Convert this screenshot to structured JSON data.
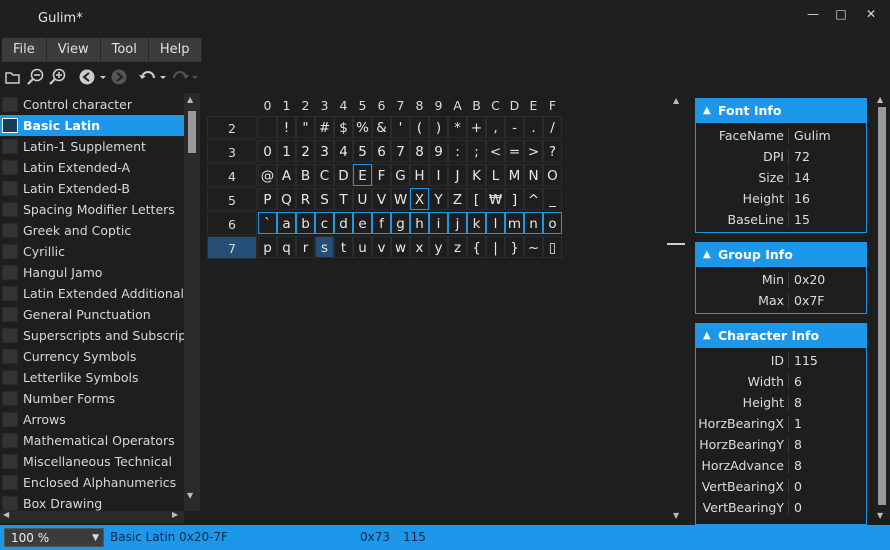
{
  "window": {
    "title": "Gulim*",
    "min_icon": "minimize-icon",
    "max_icon": "maximize-icon",
    "close_icon": "close-icon"
  },
  "menu": [
    {
      "label": "File"
    },
    {
      "label": "View"
    },
    {
      "label": "Tool"
    },
    {
      "label": "Help"
    }
  ],
  "toolbar": {
    "icons": [
      "open-folder-icon",
      "zoom-out-icon",
      "zoom-in-icon",
      "back-icon",
      "forward-icon",
      "undo-icon",
      "redo-icon"
    ]
  },
  "sidebar": {
    "items": [
      {
        "label": "Control character"
      },
      {
        "label": "Basic Latin"
      },
      {
        "label": "Latin-1 Supplement"
      },
      {
        "label": "Latin Extended-A"
      },
      {
        "label": "Latin Extended-B"
      },
      {
        "label": "Spacing Modifier Letters"
      },
      {
        "label": "Greek and Coptic"
      },
      {
        "label": "Cyrillic"
      },
      {
        "label": "Hangul Jamo"
      },
      {
        "label": "Latin Extended Additional"
      },
      {
        "label": "General Punctuation"
      },
      {
        "label": "Superscripts and Subscripts"
      },
      {
        "label": "Currency Symbols"
      },
      {
        "label": "Letterlike Symbols"
      },
      {
        "label": "Number Forms"
      },
      {
        "label": "Arrows"
      },
      {
        "label": "Mathematical Operators"
      },
      {
        "label": "Miscellaneous Technical"
      },
      {
        "label": "Enclosed Alphanumerics"
      },
      {
        "label": "Box Drawing"
      }
    ],
    "selected_index": 1
  },
  "grid": {
    "col_headers": [
      "0",
      "1",
      "2",
      "3",
      "4",
      "5",
      "6",
      "7",
      "8",
      "9",
      "A",
      "B",
      "C",
      "D",
      "E",
      "F"
    ],
    "row_headers": [
      "2",
      "3",
      "4",
      "5",
      "6",
      "7"
    ],
    "rows": [
      [
        " ",
        "!",
        "\"",
        "#",
        "$",
        "%",
        "&",
        "'",
        "(",
        ")",
        "*",
        "+",
        ",",
        "-",
        ".",
        "/"
      ],
      [
        "0",
        "1",
        "2",
        "3",
        "4",
        "5",
        "6",
        "7",
        "8",
        "9",
        ":",
        ";",
        "<",
        "=",
        ">",
        "?"
      ],
      [
        "@",
        "A",
        "B",
        "C",
        "D",
        "E",
        "F",
        "G",
        "H",
        "I",
        "J",
        "K",
        "L",
        "M",
        "N",
        "O"
      ],
      [
        "P",
        "Q",
        "R",
        "S",
        "T",
        "U",
        "V",
        "W",
        "X",
        "Y",
        "Z",
        "[",
        "₩",
        "]",
        "^",
        "_"
      ],
      [
        "`",
        "a",
        "b",
        "c",
        "d",
        "e",
        "f",
        "g",
        "h",
        "i",
        "j",
        "k",
        "l",
        "m",
        "n",
        "o"
      ],
      [
        "p",
        "q",
        "r",
        "s",
        "t",
        "u",
        "v",
        "w",
        "x",
        "y",
        "z",
        "{",
        "|",
        "}",
        "~",
        "▯"
      ]
    ],
    "selected_row": "7"
  },
  "font_info": {
    "title": "Font Info",
    "rows": [
      {
        "k": "FaceName",
        "v": "Gulim"
      },
      {
        "k": "DPI",
        "v": "72"
      },
      {
        "k": "Size",
        "v": "14"
      },
      {
        "k": "Height",
        "v": "16"
      },
      {
        "k": "BaseLine",
        "v": "15"
      }
    ]
  },
  "group_info": {
    "title": "Group Info",
    "rows": [
      {
        "k": "Min",
        "v": "0x20"
      },
      {
        "k": "Max",
        "v": "0x7F"
      }
    ]
  },
  "char_info": {
    "title": "Character Info",
    "rows": [
      {
        "k": "ID",
        "v": "115"
      },
      {
        "k": "Width",
        "v": "6"
      },
      {
        "k": "Height",
        "v": "8"
      },
      {
        "k": "HorzBearingX",
        "v": "1"
      },
      {
        "k": "HorzBearingY",
        "v": "8"
      },
      {
        "k": "HorzAdvance",
        "v": "8"
      },
      {
        "k": "VertBearingX",
        "v": "0"
      },
      {
        "k": "VertBearingY",
        "v": "0"
      }
    ]
  },
  "status": {
    "zoom": "100 %",
    "group": "Basic Latin 0x20-7F",
    "hex": "0x73",
    "dec": "115"
  }
}
